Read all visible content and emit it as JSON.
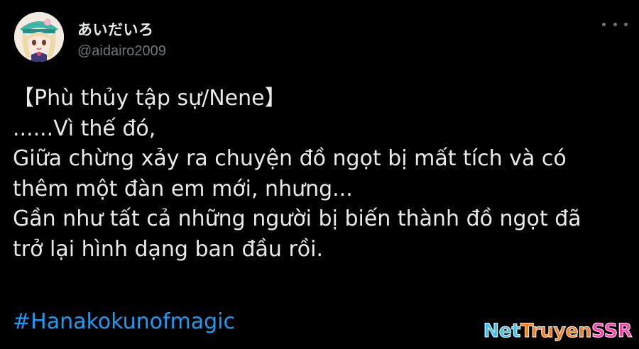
{
  "author": {
    "display_name": "あいだいろ",
    "handle": "@aidairo2009",
    "avatar_icon": "avatar-icon"
  },
  "menu": {
    "more_icon": "more-horizontal-icon"
  },
  "tweet": {
    "lines": [
      "【Phù thủy tập sự/Nene】",
      "......Vì thế đó,",
      "Giữa chừng xảy ra chuyện đồ ngọt bị mất tích và có",
      "thêm một đàn em mới, nhưng...",
      "Gần như tất cả những người bị biến thành đồ ngọt đã",
      "trở lại hình dạng ban đầu rồi."
    ],
    "hashtag": "#Hanakokunofmagic"
  },
  "watermark": {
    "part1": "Net",
    "part2": "Truyen",
    "part3": "SSR"
  },
  "colors": {
    "background": "#000000",
    "text": "#e7e9ea",
    "secondary": "#71767b",
    "link": "#1d9bf0"
  }
}
